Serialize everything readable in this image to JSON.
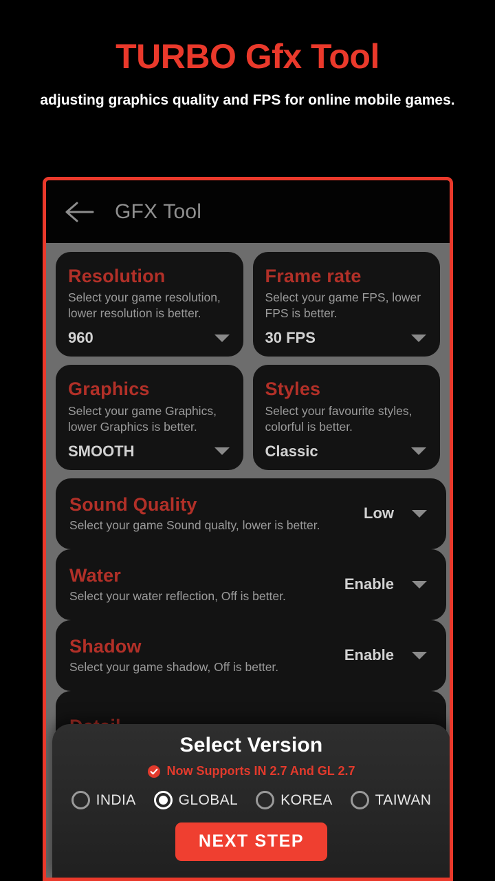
{
  "promo": {
    "title": "TURBO Gfx Tool",
    "subtitle": "adjusting graphics quality and FPS for online mobile games.",
    "title_color": "#ea392b",
    "subtitle_color": "#ffffff",
    "frame_border_color": "#ea392b"
  },
  "appbar": {
    "back_icon": "arrow-left-icon",
    "title": "GFX Tool"
  },
  "settings": {
    "grid_cards": [
      {
        "id": "resolution",
        "title": "Resolution",
        "description": "Select your game resolution, lower resolution is better.",
        "value": "960",
        "caret": "chevron-down-icon"
      },
      {
        "id": "frame-rate",
        "title": "Frame rate",
        "description": "Select your game FPS, lower FPS is better.",
        "value": "30 FPS",
        "caret": "chevron-down-icon"
      },
      {
        "id": "graphics",
        "title": "Graphics",
        "description": "Select your game Graphics, lower Graphics is better.",
        "value": "SMOOTH",
        "caret": "chevron-down-icon"
      },
      {
        "id": "styles",
        "title": "Styles",
        "description": "Select your favourite styles, colorful is better.",
        "value": "Classic",
        "caret": "chevron-down-icon"
      }
    ],
    "full_cards": [
      {
        "id": "sound-quality",
        "title": "Sound Quality",
        "description": "Select your game Sound qualty, lower is better.",
        "value": "Low",
        "caret": "chevron-down-icon"
      },
      {
        "id": "water",
        "title": "Water",
        "description": "Select your water reflection, Off is better.",
        "value": "Enable",
        "caret": "chevron-down-icon"
      },
      {
        "id": "shadow",
        "title": "Shadow",
        "description": "Select your game shadow, Off is better.",
        "value": "Enable",
        "caret": "chevron-down-icon"
      }
    ],
    "clipped_card": {
      "id": "detail",
      "title": "Detail"
    }
  },
  "sheet": {
    "title": "Select Version",
    "note": "Now Supports IN 2.7 And GL 2.7",
    "note_icon": "check-circle-icon",
    "note_color": "#e23a2c",
    "versions": [
      {
        "label": "INDIA",
        "selected": false
      },
      {
        "label": "GLOBAL",
        "selected": true
      },
      {
        "label": "KOREA",
        "selected": false
      },
      {
        "label": "TAIWAN",
        "selected": false
      }
    ],
    "next_button": "NEXT STEP",
    "next_button_color": "#ef3f30"
  }
}
